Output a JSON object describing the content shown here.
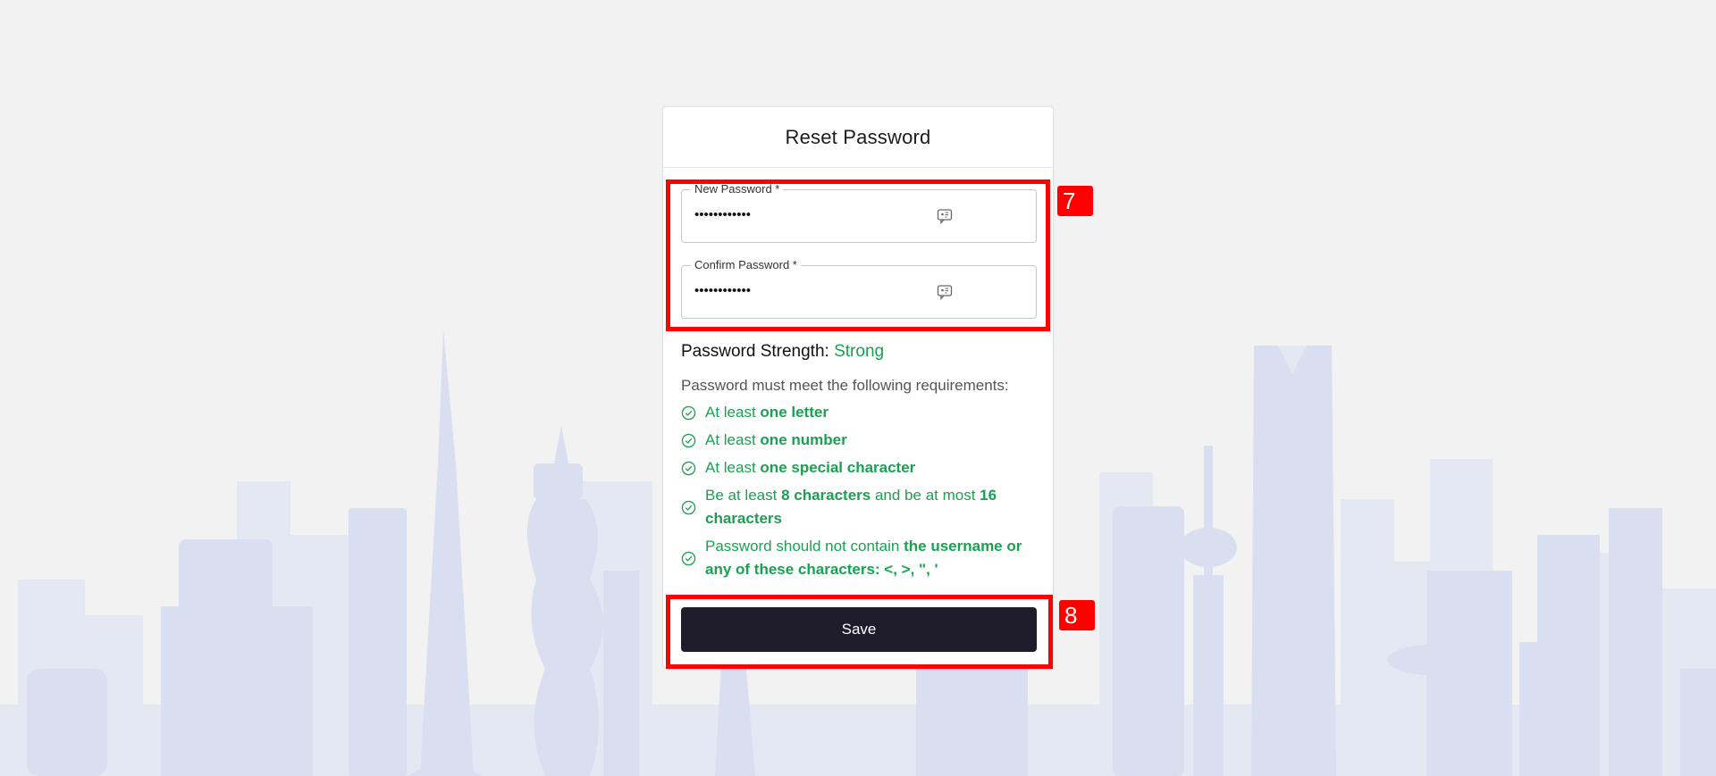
{
  "card": {
    "title": "Reset Password"
  },
  "fields": {
    "new_password": {
      "label": "New Password *",
      "value": "••••••••••••",
      "icon": "eye-toggle-icon"
    },
    "confirm_password": {
      "label": "Confirm Password *",
      "value": "••••••••••••",
      "icon": "eye-toggle-icon"
    }
  },
  "strength": {
    "label": "Password Strength:",
    "value": "Strong"
  },
  "requirements": {
    "intro": "Password must meet the following requirements:",
    "items": [
      {
        "pre": "At least ",
        "bold1": "one letter",
        "mid": "",
        "bold2": ""
      },
      {
        "pre": "At least ",
        "bold1": "one number",
        "mid": "",
        "bold2": ""
      },
      {
        "pre": "At least ",
        "bold1": "one special character",
        "mid": "",
        "bold2": ""
      },
      {
        "pre": "Be at least ",
        "bold1": "8 characters",
        "mid": " and be at most ",
        "bold2": "16 characters"
      },
      {
        "pre": "Password should not contain ",
        "bold1": "the username or any of these characters: <, >, \", '",
        "mid": "",
        "bold2": ""
      }
    ]
  },
  "actions": {
    "save_label": "Save"
  },
  "annotations": {
    "fields_marker": "7",
    "save_marker": "8"
  },
  "colors": {
    "success": "#1aa152",
    "button_bg": "#1e1b2b",
    "annotation": "#ff0000",
    "skyline": "#dde2f1"
  }
}
